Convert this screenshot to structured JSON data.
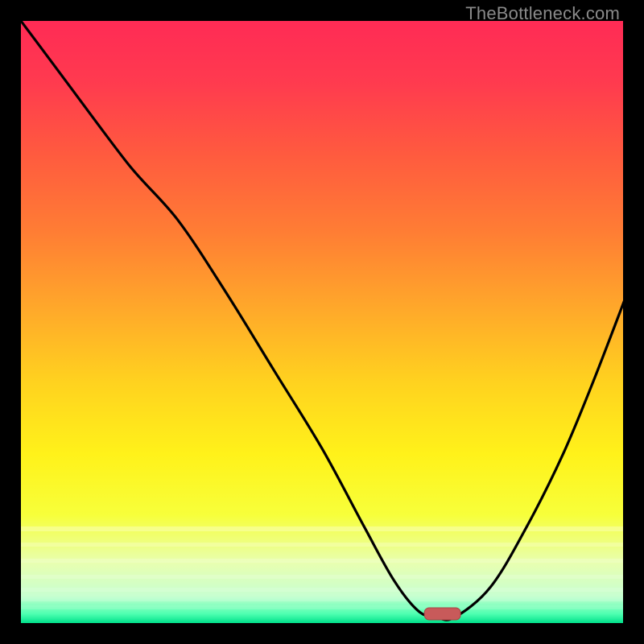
{
  "watermark": "TheBottleneck.com",
  "colors": {
    "frame": "#000000",
    "curve": "#000000",
    "marker_fill": "#c85a5a",
    "marker_stroke": "#a84444",
    "gradient_stops": [
      {
        "offset": 0.0,
        "color": "#ff2b55"
      },
      {
        "offset": 0.1,
        "color": "#ff3a4f"
      },
      {
        "offset": 0.22,
        "color": "#ff5a3f"
      },
      {
        "offset": 0.35,
        "color": "#ff7d34"
      },
      {
        "offset": 0.48,
        "color": "#ffa92a"
      },
      {
        "offset": 0.6,
        "color": "#ffd21f"
      },
      {
        "offset": 0.72,
        "color": "#fff21a"
      },
      {
        "offset": 0.82,
        "color": "#f7ff3a"
      },
      {
        "offset": 0.9,
        "color": "#e8ffb0"
      },
      {
        "offset": 0.955,
        "color": "#c8ffd0"
      },
      {
        "offset": 0.985,
        "color": "#4dffb0"
      },
      {
        "offset": 1.0,
        "color": "#00e08a"
      }
    ]
  },
  "chart_data": {
    "type": "line",
    "title": "",
    "xlabel": "",
    "ylabel": "",
    "xlim": [
      0,
      100
    ],
    "ylim": [
      0,
      100
    ],
    "x": [
      0,
      9,
      18,
      26,
      34,
      42,
      50,
      57,
      62,
      66,
      69,
      72,
      78,
      84,
      90,
      95,
      100
    ],
    "values": [
      100,
      88,
      76,
      67,
      55,
      42,
      29,
      16,
      7,
      2,
      0,
      0,
      6,
      16,
      28,
      40,
      53
    ],
    "marker": {
      "x": 70,
      "y": 0,
      "rx": 3.0,
      "ry": 1.0
    },
    "note": "x and y are in percent of the plot area; (0,0) is bottom-left. Values are visual estimates from the rendered curve (no axis labels present)."
  }
}
